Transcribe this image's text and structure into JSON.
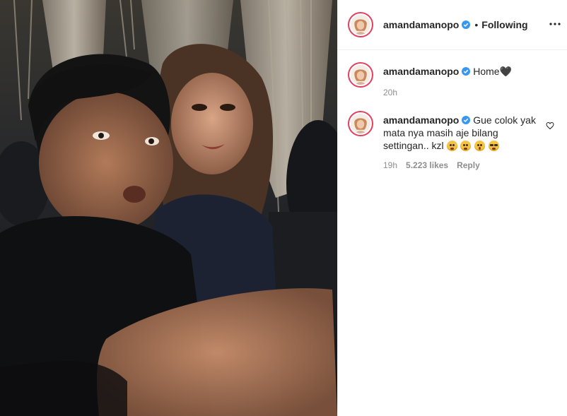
{
  "post": {
    "author": {
      "username": "amandamanopo",
      "verified": true,
      "follow_status": "Following",
      "separator": "•"
    },
    "caption": {
      "username": "amandamanopo",
      "text": "Home",
      "emoji": "🖤",
      "time": "20h"
    },
    "comments": [
      {
        "username": "amandamanopo",
        "text": "Gue colok yak mata nya masih aje bilang settingan.. kzl",
        "time": "19h",
        "likes": "5.223 likes",
        "reply_label": "Reply",
        "emojis": [
          "weary-face",
          "weary-face",
          "astonished-face",
          "sunglasses-face"
        ]
      }
    ]
  },
  "colors": {
    "story_ring": "#e4405f",
    "verified": "#3897f0",
    "secondary_text": "#8e8e8e",
    "primary_text": "#262626"
  },
  "icons": {
    "more": "more-options-icon",
    "verified": "verified-badge-icon",
    "like": "heart-icon"
  }
}
